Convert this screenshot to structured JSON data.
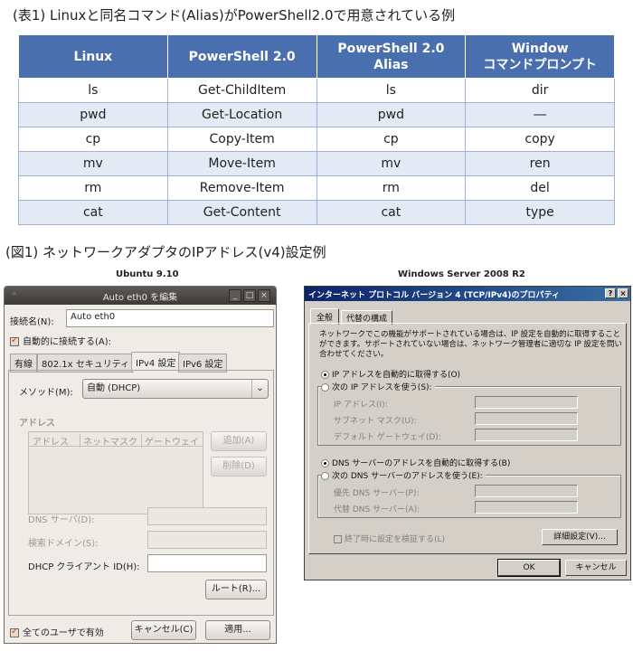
{
  "captions": {
    "table": "(表1) Linuxと同名コマンド(Alias)がPowerShell2.0で用意されている例",
    "figure": "(図1) ネットワークアダプタのIPアドレス(v4)設定例"
  },
  "table": {
    "headers": [
      "Linux",
      "PowerShell 2.0",
      "PowerShell 2.0\nAlias",
      "Window\nコマンドプロンプト"
    ],
    "rows": [
      [
        "ls",
        "Get-ChildItem",
        "ls",
        "dir"
      ],
      [
        "pwd",
        "Get-Location",
        "pwd",
        "―"
      ],
      [
        "cp",
        "Copy-Item",
        "cp",
        "copy"
      ],
      [
        "mv",
        "Move-Item",
        "mv",
        "ren"
      ],
      [
        "rm",
        "Remove-Item",
        "rm",
        "del"
      ],
      [
        "cat",
        "Get-Content",
        "cat",
        "type"
      ]
    ]
  },
  "ubuntu": {
    "caption": "Ubuntu 9.10",
    "title": "Auto eth0 を編集",
    "conn_name_label": "接続名(N):",
    "conn_name_value": "Auto eth0",
    "auto_connect_label": "自動的に接続する(A):",
    "tabs": [
      "有線",
      "802.1x セキュリティ",
      "IPv4 設定",
      "IPv6 設定"
    ],
    "method_label": "メソッド(M):",
    "method_value": "自動 (DHCP)",
    "address_section": "アドレス",
    "address_columns": [
      "アドレス",
      "ネットマスク",
      "ゲートウェイ"
    ],
    "add_button": "追加(A)",
    "delete_button": "削除(D)",
    "dns_label": "DNS サーバ(D):",
    "search_domain_label": "検索ドメイン(S):",
    "dhcp_client_label": "DHCP クライアント ID(H):",
    "route_button": "ルート(R)...",
    "all_users_label": "全てのユーザで有効",
    "cancel_button": "キャンセル(C)",
    "apply_button": "適用..."
  },
  "windows": {
    "caption": "Windows Server 2008 R2",
    "title": "インターネット プロトコル バージョン 4 (TCP/IPv4)のプロパティ",
    "tabs": [
      "全般",
      "代替の構成"
    ],
    "description": "ネットワークでこの機能がサポートされている場合は、IP 設定を自動的に取得することができます。サポートされていない場合は、ネットワーク管理者に適切な IP 設定を問い合わせてください。",
    "ip_auto": "IP アドレスを自動的に取得する(O)",
    "ip_manual": "次の IP アドレスを使う(S):",
    "ip_address_label": "IP アドレス(I):",
    "subnet_label": "サブネット マスク(U):",
    "gateway_label": "デフォルト ゲートウェイ(D):",
    "dns_auto": "DNS サーバーのアドレスを自動的に取得する(B)",
    "dns_manual": "次の DNS サーバーのアドレスを使う(E):",
    "preferred_dns_label": "優先 DNS サーバー(P):",
    "alternate_dns_label": "代替 DNS サーバー(A):",
    "validate_label": "終了時に設定を検証する(L)",
    "advanced_button": "詳細設定(V)...",
    "ok_button": "OK",
    "cancel_button": "キャンセル"
  }
}
